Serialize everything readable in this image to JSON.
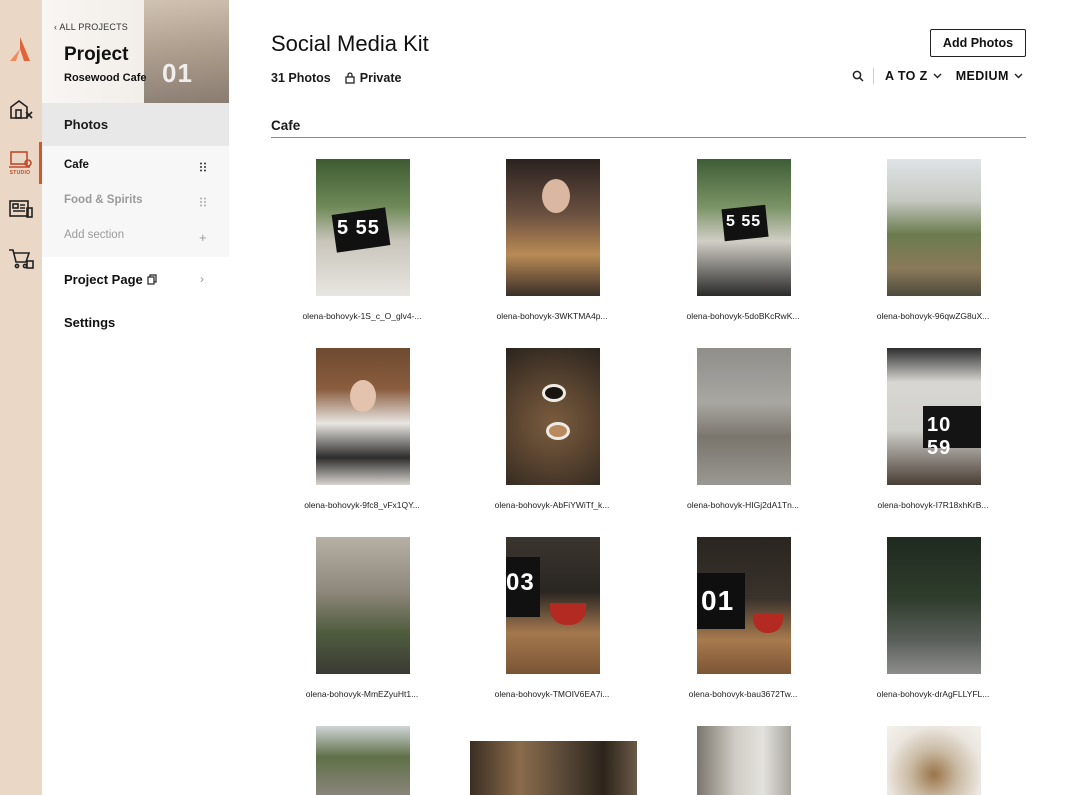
{
  "rail": {
    "items": [
      "logo",
      "property-icon",
      "studio-icon",
      "gallery-icon",
      "cart-icon"
    ],
    "studio_label": "STUDIO"
  },
  "sidebar": {
    "back_label": "‹ ALL PROJECTS",
    "project_label": "Project",
    "project_name": "Rosewood Cafe",
    "hero_number": "01",
    "photos_label": "Photos",
    "sections": [
      {
        "label": "Cafe",
        "active": true
      },
      {
        "label": "Food & Spirits",
        "active": false
      }
    ],
    "add_section_label": "Add section",
    "project_page_label": "Project Page",
    "settings_label": "Settings"
  },
  "main": {
    "title": "Social Media Kit",
    "photo_count": "31 Photos",
    "privacy": "Private",
    "add_button": "Add Photos",
    "sort_label": "A TO Z",
    "size_label": "MEDIUM",
    "section_title": "Cafe"
  },
  "photos": [
    {
      "caption": "olena-bohovyk-1S_c_O_glv4-...",
      "overlay": "5 55"
    },
    {
      "caption": "olena-bohovyk-3WKTMA4p...",
      "overlay": ""
    },
    {
      "caption": "olena-bohovyk-5doBKcRwK...",
      "overlay": "5 55"
    },
    {
      "caption": "olena-bohovyk-96qwZG8uX...",
      "overlay": ""
    },
    {
      "caption": "olena-bohovyk-9fc8_vFx1QY...",
      "overlay": ""
    },
    {
      "caption": "olena-bohovyk-AbFiYWiTf_k...",
      "overlay": ""
    },
    {
      "caption": "olena-bohovyk-HIGj2dA1Tn...",
      "overlay": ""
    },
    {
      "caption": "olena-bohovyk-I7R18xhKrB...",
      "overlay": "10 59"
    },
    {
      "caption": "olena-bohovyk-MmEZyuHt1...",
      "overlay": ""
    },
    {
      "caption": "olena-bohovyk-TMOIV6EA7i...",
      "overlay": "03"
    },
    {
      "caption": "olena-bohovyk-bau3672Tw...",
      "overlay": "01"
    },
    {
      "caption": "olena-bohovyk-drAgFLLYFL...",
      "overlay": ""
    },
    {
      "caption": "",
      "overlay": ""
    },
    {
      "caption": "",
      "overlay": ""
    },
    {
      "caption": "",
      "overlay": ""
    },
    {
      "caption": "",
      "overlay": ""
    }
  ]
}
